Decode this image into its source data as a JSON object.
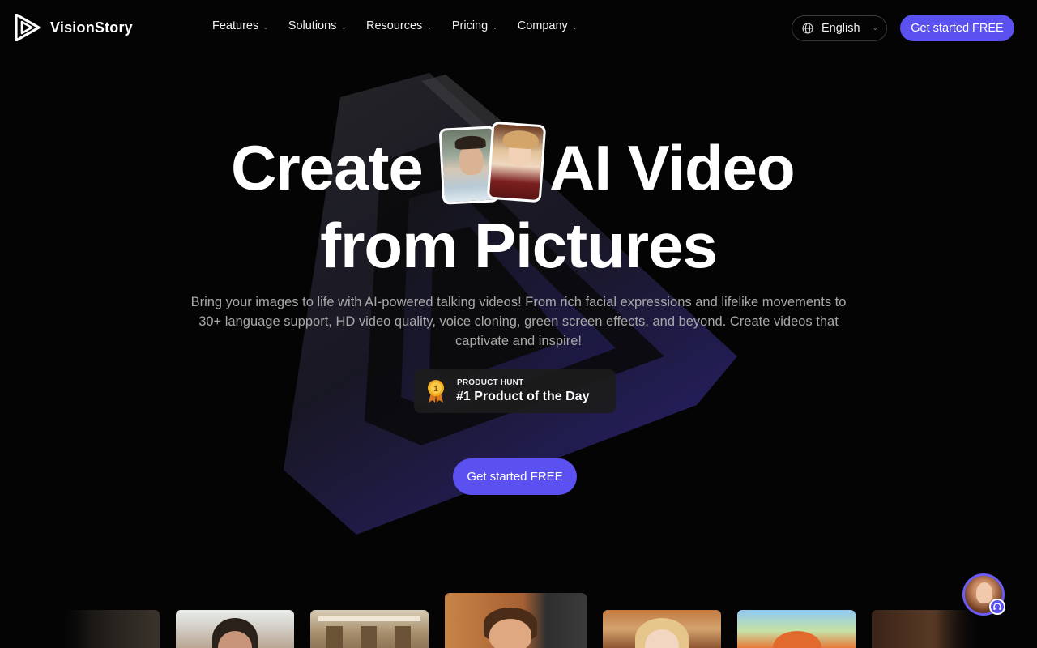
{
  "brand": {
    "name": "VisionStory"
  },
  "nav": {
    "items": [
      {
        "label": "Features"
      },
      {
        "label": "Solutions"
      },
      {
        "label": "Resources"
      },
      {
        "label": "Pricing"
      },
      {
        "label": "Company"
      }
    ],
    "language": "English",
    "cta": "Get started FREE"
  },
  "hero": {
    "title_part1": "Create",
    "title_part2": "AI Video",
    "title_line2": "from Pictures",
    "subtitle": "Bring your images to life with AI-powered talking videos! From rich facial expressions and lifelike movements to 30+ language support, HD video quality, voice cloning, green screen effects, and beyond. Create videos that captivate and inspire!",
    "badge_small": "PRODUCT HUNT",
    "badge_big": "#1 Product of the Day",
    "medal_number": "1",
    "cta": "Get started FREE"
  },
  "colors": {
    "accent": "#5b50f0",
    "background": "#040404",
    "subtext": "#a8a8a8"
  },
  "icons": {
    "logo": "play-triangle-logo-icon",
    "language": "globe-icon",
    "dropdown": "chevron-down-icon",
    "badge": "gold-medal-icon",
    "support": "headset-icon"
  }
}
